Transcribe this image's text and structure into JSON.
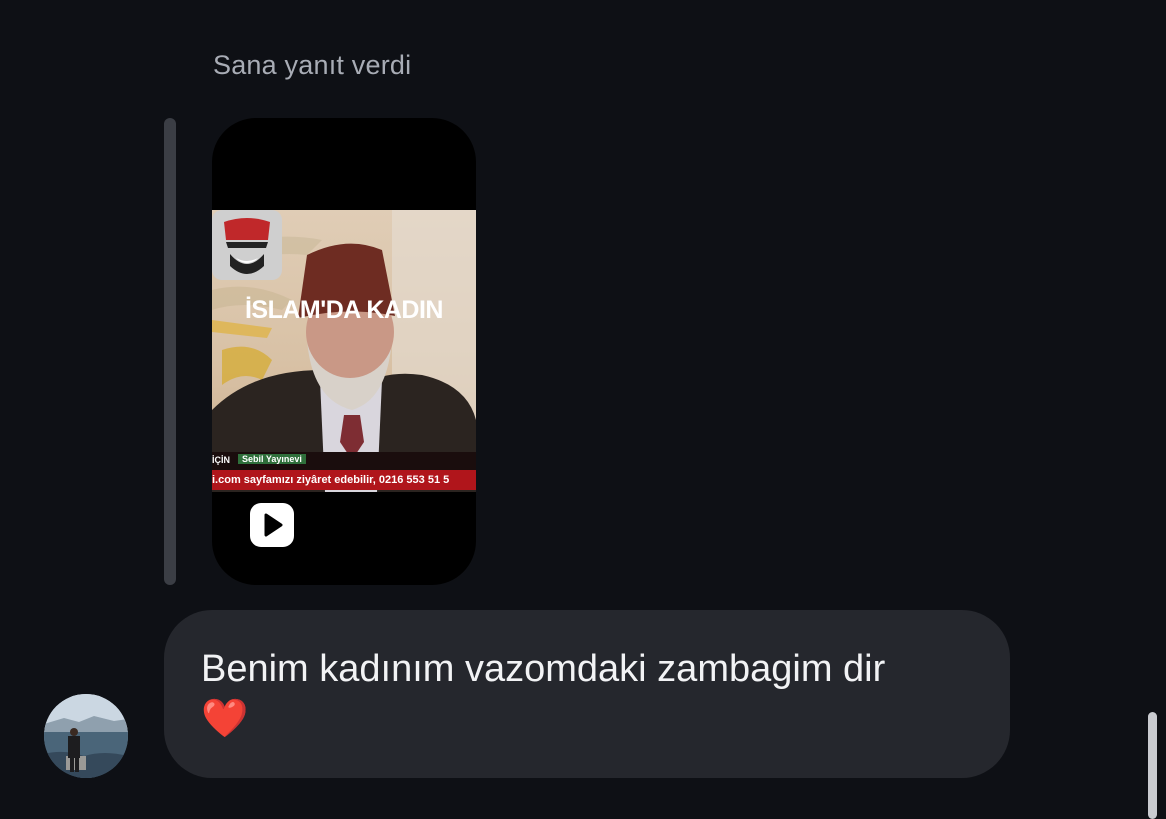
{
  "reply": {
    "label": "Sana yanıt verdi"
  },
  "reel": {
    "title": "İSLAM'DA KADIN",
    "ticker_tag": "İÇİN",
    "ticker_channel": "Sebil Yayınevi",
    "ticker_text": "i.com sayfamızı ziyâret edebilir, 0216 553 51 5",
    "play_icon": "play-icon"
  },
  "message": {
    "text": "Benim kadınım vazomdaki zambagim dir",
    "emoji": "❤️"
  },
  "avatar": {
    "icon": "user-avatar"
  },
  "colors": {
    "background": "#0e1015",
    "bubble": "#25272d",
    "reply_bar": "#3b3e45",
    "muted_text": "#a8acb5"
  }
}
